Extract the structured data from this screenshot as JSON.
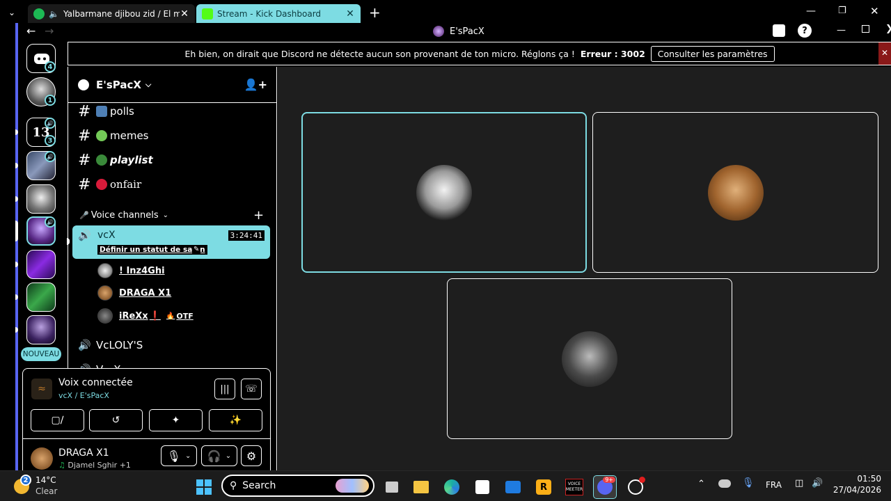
{
  "browser": {
    "tabs": [
      {
        "title": "Yalbarmane djibou zid / El me",
        "active": false
      },
      {
        "title": "Stream - Kick Dashboard",
        "active": true
      }
    ],
    "new_tab": "+",
    "nav_back": "←",
    "nav_forward": "→"
  },
  "app": {
    "title": "E'sPacX",
    "accent": "#7ddce3",
    "brand": "#5865f2"
  },
  "notice": {
    "message": "Eh bien, on dirait que Discord ne détecte aucun son provenant de ton micro. Réglons ça !",
    "error_label": "Erreur : 3002",
    "button": "Consulter les paramètres"
  },
  "rail": {
    "dm_badge": "4",
    "servers": [
      {
        "badge": "1",
        "voice": false
      },
      {
        "badge": "3",
        "voice": true,
        "label": "13"
      },
      {
        "badge": null,
        "voice": true
      },
      {
        "badge": null,
        "voice": false
      },
      {
        "badge": null,
        "voice": true,
        "selected": true
      },
      {
        "badge": null,
        "voice": false
      },
      {
        "badge": null,
        "voice": false
      },
      {
        "badge": null,
        "voice": false
      }
    ],
    "new_label": "NOUVEAU"
  },
  "sidebar": {
    "server_name": "E'sPacX",
    "text_channels": [
      {
        "name": "polls",
        "emoji_color": "#4e7fb5"
      },
      {
        "name": "memes",
        "emoji_color": "#73c957"
      },
      {
        "name": "playlist",
        "emoji_color": "#3a8a3a"
      },
      {
        "name": "onfair",
        "emoji_color": "#d81b3a"
      }
    ],
    "voice_category": "Voice channels",
    "active_voice": {
      "name": "vcX",
      "timer": "3:24:41",
      "status_link": "Définir un statut de salon"
    },
    "members": [
      {
        "name": "! Inz4Ghi",
        "tag": ""
      },
      {
        "name": "DRAGA X1",
        "tag": ""
      },
      {
        "name": "iReXx",
        "tag": "OTF"
      }
    ],
    "other_voice": [
      {
        "name": "VcLOLY'S"
      },
      {
        "name": "V - X"
      }
    ]
  },
  "voice_panel": {
    "status": "Voix connectée",
    "channel": "vcX / E'sPacX"
  },
  "user_panel": {
    "name": "DRAGA X1",
    "activity": "Djamel Sghir +1"
  },
  "taskbar": {
    "weather_temp": "14°C",
    "weather_desc": "Clear",
    "weather_badge": "2",
    "search_label": "Search",
    "lang": "FRA",
    "time": "01:50",
    "date": "27/04/2026",
    "discord_badge": "9+",
    "voicemeeter_label": "VOICE MEETER"
  }
}
